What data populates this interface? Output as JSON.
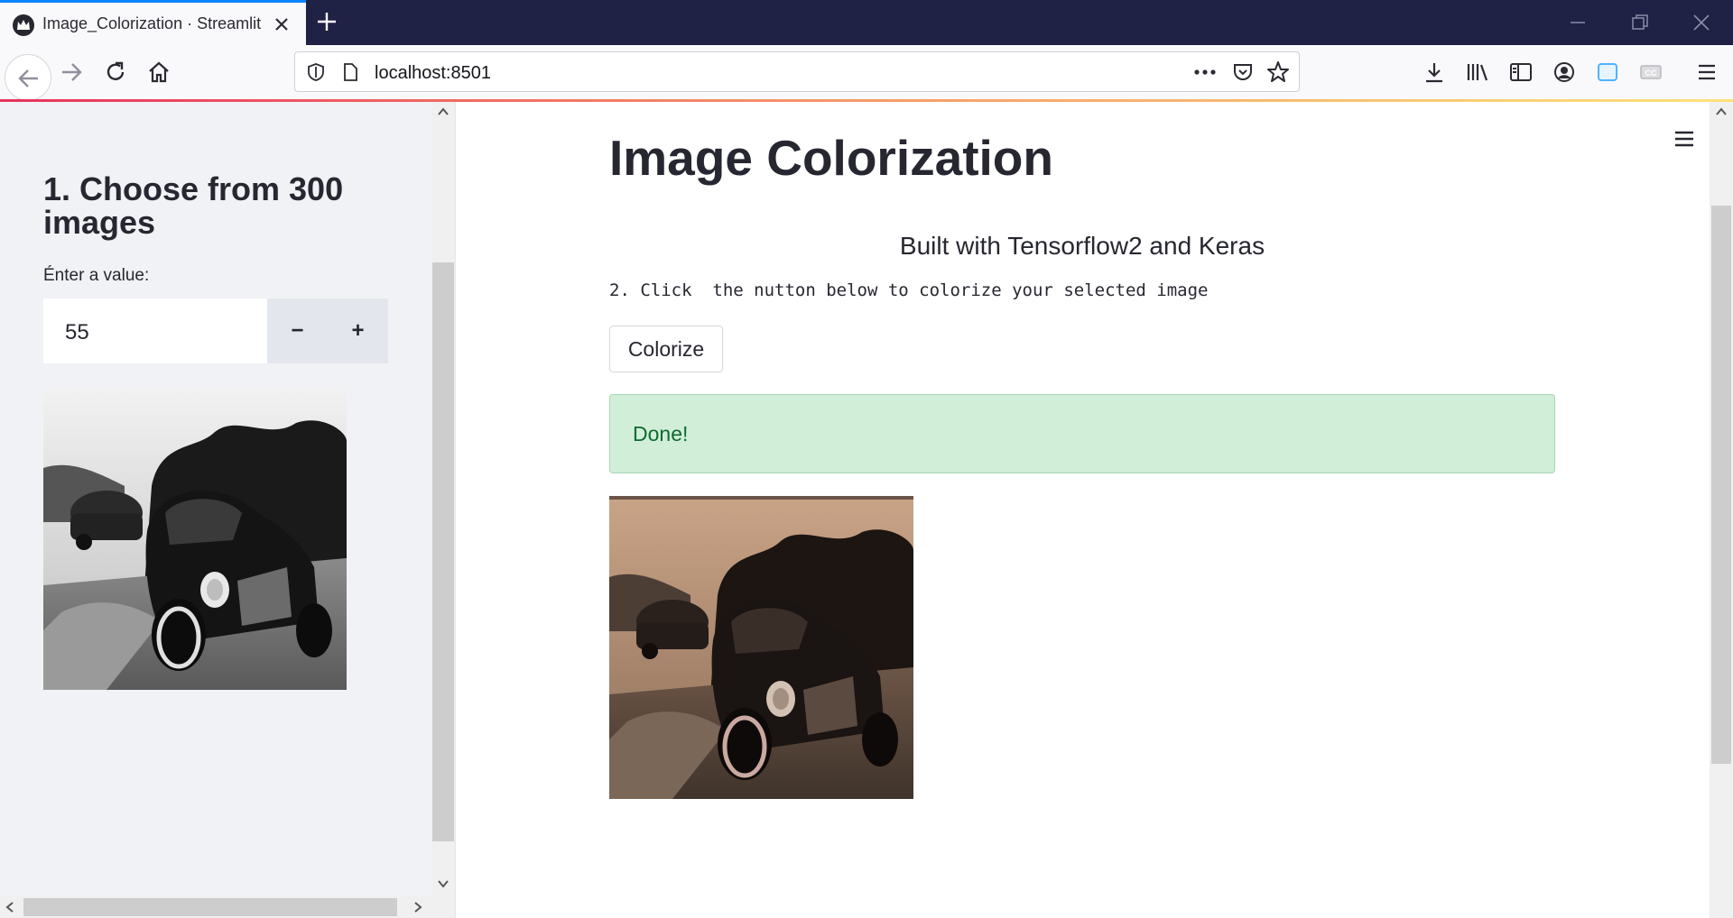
{
  "browser": {
    "tab_title": "Image_Colorization · Streamlit",
    "url": "localhost:8501"
  },
  "sidebar": {
    "heading": "1. Choose from 300 images",
    "input_label": "Énter a value:",
    "input_value": "55",
    "minus_label": "−",
    "plus_label": "+"
  },
  "main": {
    "title": "Image Colorization",
    "subtitle": "Built with Tensorflow2 and Keras",
    "instruction": "2. Click  the nutton below to colorize your selected image",
    "colorize_button": "Colorize",
    "status_message": "Done!"
  },
  "colors": {
    "sidebar_bg": "#f0f2f6",
    "success_bg": "#d1eed8",
    "success_text": "#0e6a2f",
    "text": "#262730",
    "tab_accent": "#0a84ff"
  }
}
